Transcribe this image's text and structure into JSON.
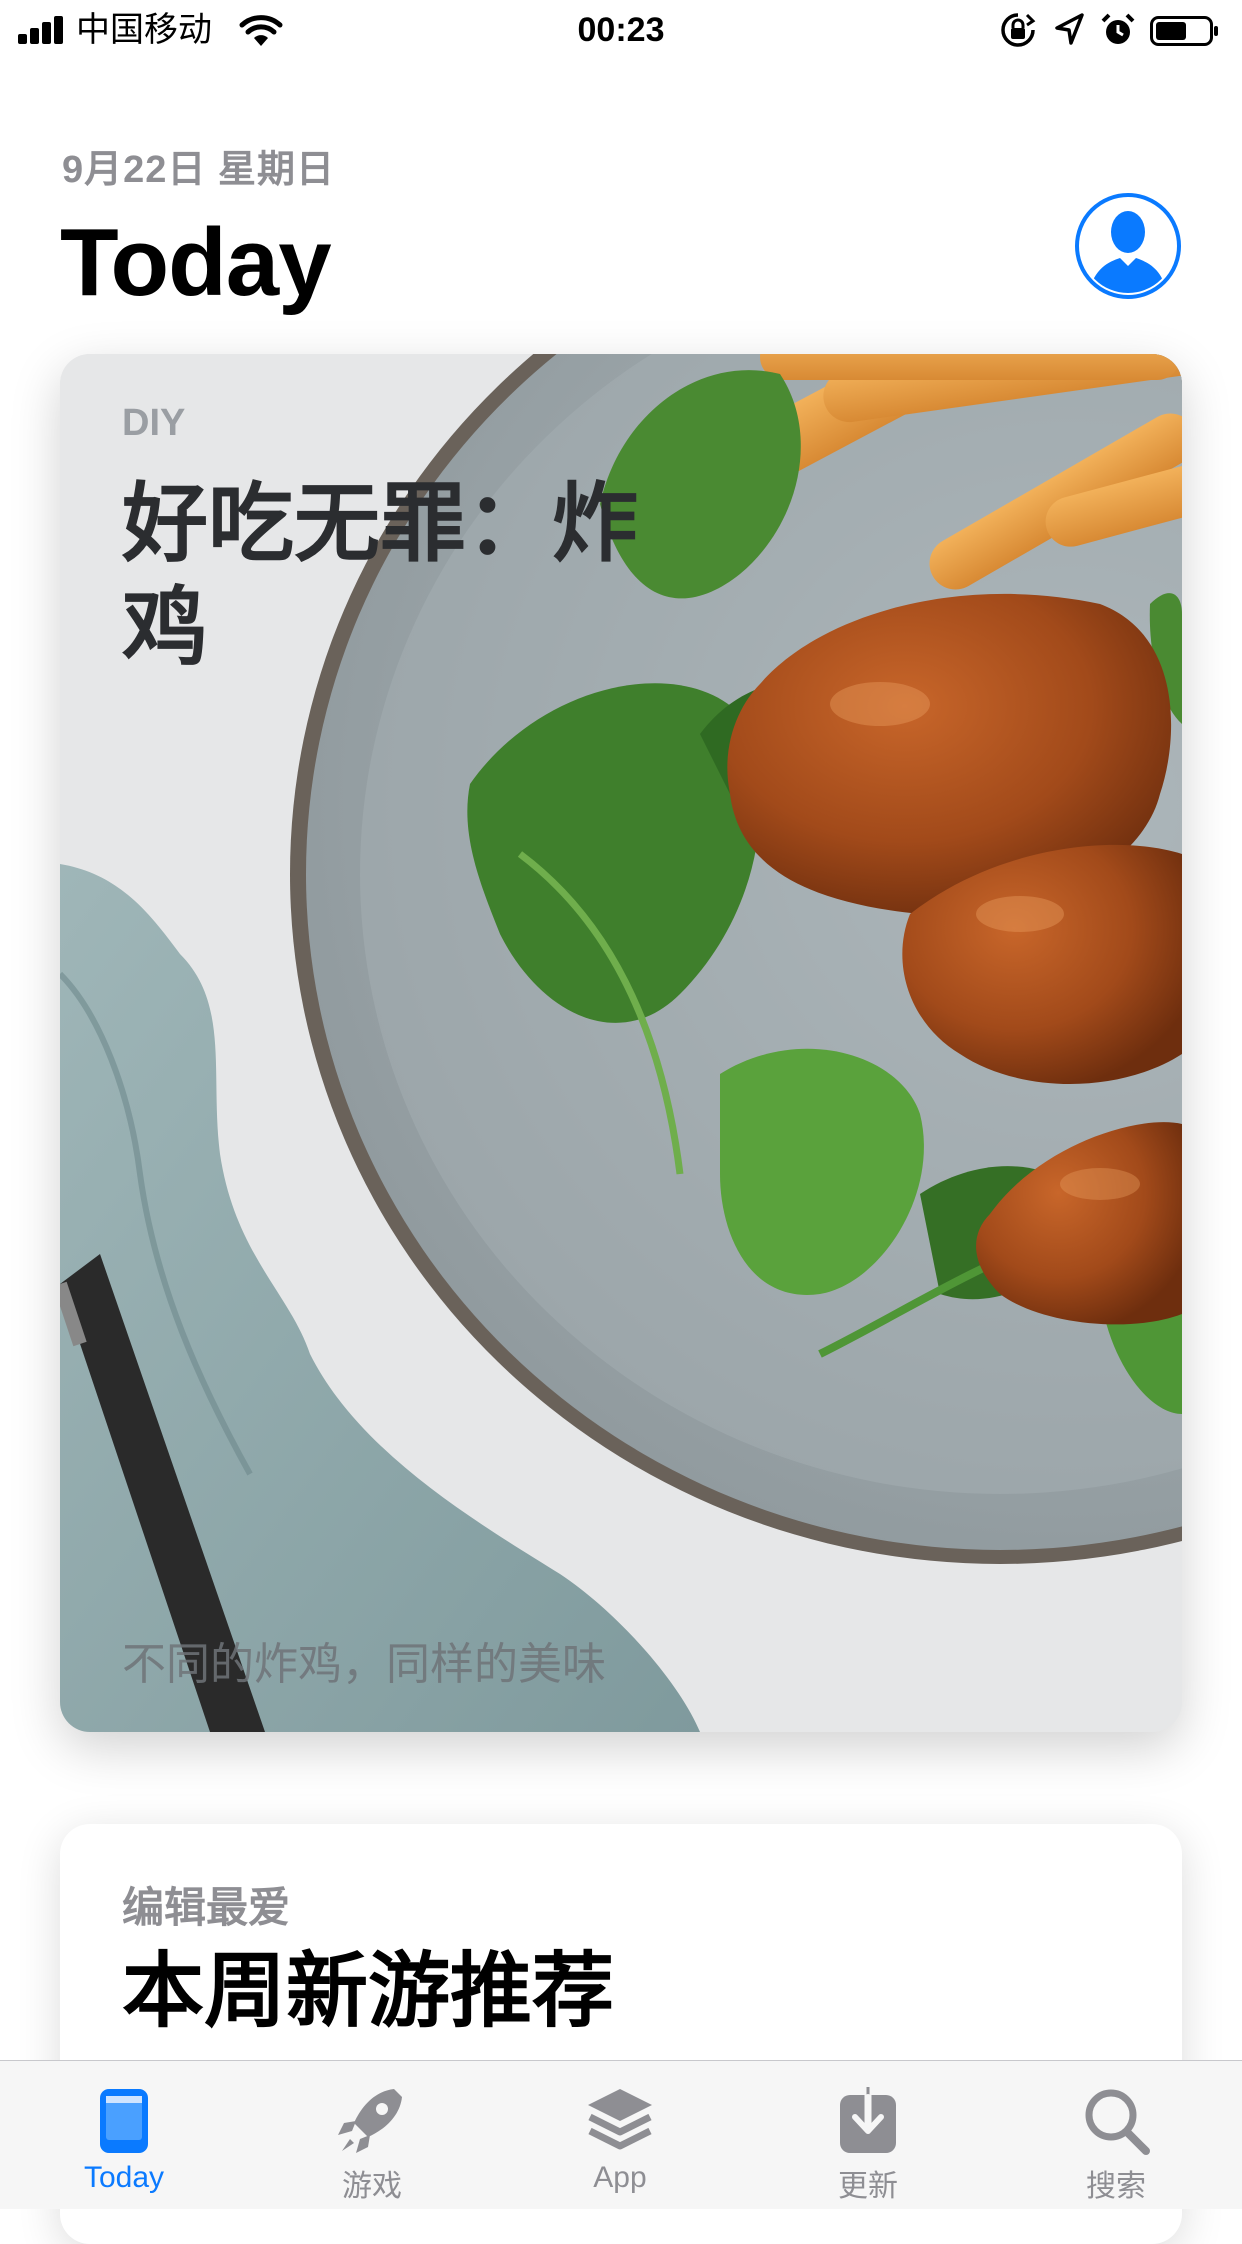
{
  "status_bar": {
    "carrier": "中国移动",
    "time": "00:23",
    "icons": [
      "signal-icon",
      "wifi-icon",
      "rotation-lock-icon",
      "location-icon",
      "alarm-icon",
      "battery-icon"
    ]
  },
  "header": {
    "date": "9月22日 星期日",
    "title": "Today",
    "account_icon": "person-circle-icon"
  },
  "featured_card": {
    "tag": "DIY",
    "title": "好吃无罪：炸鸡",
    "subtitle": "不同的炸鸡，同样的美味"
  },
  "second_card": {
    "tag": "编辑最爱",
    "title": "本周新游推荐"
  },
  "tab_bar": {
    "tabs": [
      {
        "label": "Today",
        "icon": "today-icon",
        "active": true
      },
      {
        "label": "游戏",
        "icon": "rocket-icon",
        "active": false
      },
      {
        "label": "App",
        "icon": "layers-icon",
        "active": false
      },
      {
        "label": "更新",
        "icon": "download-icon",
        "active": false
      },
      {
        "label": "搜索",
        "icon": "search-icon",
        "active": false
      }
    ]
  },
  "colors": {
    "accent": "#0a7aff",
    "inactive": "#8e8e93"
  }
}
